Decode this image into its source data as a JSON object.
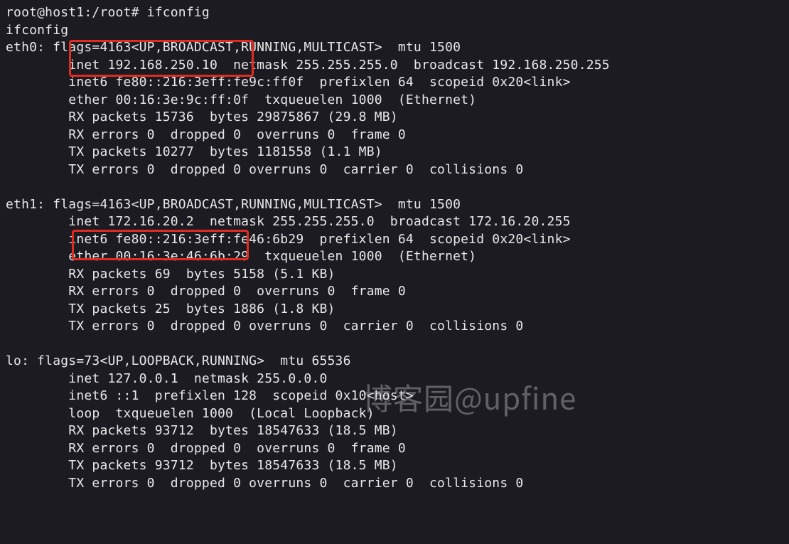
{
  "prompt": "root@host1:/root# ifconfig",
  "echo": "ifconfig",
  "watermark": "博客园@upfine",
  "highlighted": {
    "eth0_inet": "inet 192.168.250.10",
    "eth1_inet": "inet 172.16.20.2"
  },
  "interfaces": [
    {
      "name": "eth0",
      "flags_raw": "flags=4163<UP,BROADCAST,RUNNING,MULTICAST>  mtu 1500",
      "inet": "192.168.250.10",
      "netmask": "255.255.255.0",
      "broadcast": "192.168.250.255",
      "inet6": "fe80::216:3eff:fe9c:ff0f",
      "prefixlen": "64",
      "scopeid": "0x20<link>",
      "ether": "00:16:3e:9c:ff:0f",
      "txqueuelen": "1000",
      "type": "(Ethernet)",
      "rx_packets": "15736",
      "rx_bytes": "29875867 (29.8 MB)",
      "rx_errors": "RX errors 0  dropped 0  overruns 0  frame 0",
      "tx_packets": "10277",
      "tx_bytes": "1181558 (1.1 MB)",
      "tx_errors": "TX errors 0  dropped 0 overruns 0  carrier 0  collisions 0"
    },
    {
      "name": "eth1",
      "flags_raw": "flags=4163<UP,BROADCAST,RUNNING,MULTICAST>  mtu 1500",
      "inet": "172.16.20.2",
      "netmask": "255.255.255.0",
      "broadcast": "172.16.20.255",
      "inet6": "fe80::216:3eff:fe46:6b29",
      "prefixlen": "64",
      "scopeid": "0x20<link>",
      "ether": "00:16:3e:46:6b:29",
      "txqueuelen": "1000",
      "type": "(Ethernet)",
      "rx_packets": "69",
      "rx_bytes": "5158 (5.1 KB)",
      "rx_errors": "RX errors 0  dropped 0  overruns 0  frame 0",
      "tx_packets": "25",
      "tx_bytes": "1886 (1.8 KB)",
      "tx_errors": "TX errors 0  dropped 0 overruns 0  carrier 0  collisions 0"
    },
    {
      "name": "lo",
      "flags_raw": "flags=73<UP,LOOPBACK,RUNNING>  mtu 65536",
      "inet": "127.0.0.1",
      "netmask": "255.0.0.0",
      "inet6": "::1",
      "prefixlen": "128",
      "scopeid": "0x10<host>",
      "loop": "loop  txqueuelen 1000  (Local Loopback)",
      "rx_packets": "93712",
      "rx_bytes": "18547633 (18.5 MB)",
      "rx_errors": "RX errors 0  dropped 0  overruns 0  frame 0",
      "tx_packets": "93712",
      "tx_bytes": "18547633 (18.5 MB)",
      "tx_errors": "TX errors 0  dropped 0 overruns 0  carrier 0  collisions 0"
    }
  ],
  "rendered_lines": [
    "root@host1:/root# ifconfig",
    "ifconfig",
    "eth0: flags=4163<UP,BROADCAST,RUNNING,MULTICAST>  mtu 1500",
    "        inet 192.168.250.10  netmask 255.255.255.0  broadcast 192.168.250.255",
    "        inet6 fe80::216:3eff:fe9c:ff0f  prefixlen 64  scopeid 0x20<link>",
    "        ether 00:16:3e:9c:ff:0f  txqueuelen 1000  (Ethernet)",
    "        RX packets 15736  bytes 29875867 (29.8 MB)",
    "        RX errors 0  dropped 0  overruns 0  frame 0",
    "        TX packets 10277  bytes 1181558 (1.1 MB)",
    "        TX errors 0  dropped 0 overruns 0  carrier 0  collisions 0",
    "",
    "eth1: flags=4163<UP,BROADCAST,RUNNING,MULTICAST>  mtu 1500",
    "        inet 172.16.20.2  netmask 255.255.255.0  broadcast 172.16.20.255",
    "        inet6 fe80::216:3eff:fe46:6b29  prefixlen 64  scopeid 0x20<link>",
    "        ether 00:16:3e:46:6b:29  txqueuelen 1000  (Ethernet)",
    "        RX packets 69  bytes 5158 (5.1 KB)",
    "        RX errors 0  dropped 0  overruns 0  frame 0",
    "        TX packets 25  bytes 1886 (1.8 KB)",
    "        TX errors 0  dropped 0 overruns 0  carrier 0  collisions 0",
    "",
    "lo: flags=73<UP,LOOPBACK,RUNNING>  mtu 65536",
    "        inet 127.0.0.1  netmask 255.0.0.0",
    "        inet6 ::1  prefixlen 128  scopeid 0x10<host>",
    "        loop  txqueuelen 1000  (Local Loopback)",
    "        RX packets 93712  bytes 18547633 (18.5 MB)",
    "        RX errors 0  dropped 0  overruns 0  frame 0",
    "        TX packets 93712  bytes 18547633 (18.5 MB)",
    "        TX errors 0  dropped 0 overruns 0  carrier 0  collisions 0"
  ]
}
